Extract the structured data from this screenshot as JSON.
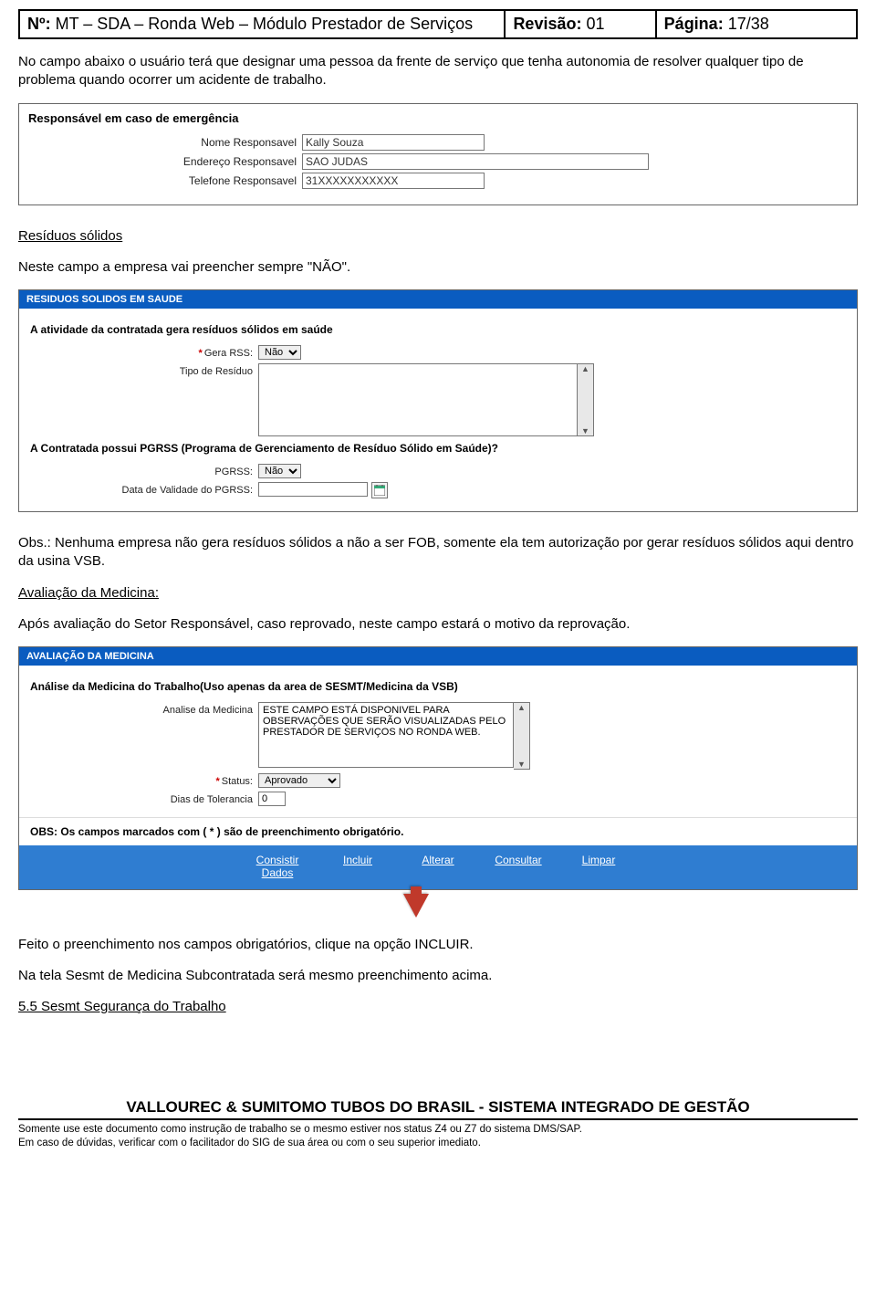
{
  "header": {
    "left_label": "Nº:",
    "left_value": "MT – SDA – Ronda Web – Módulo Prestador de Serviços",
    "mid_label": "Revisão:",
    "mid_value": "01",
    "right_label": "Página:",
    "right_value": "17/38"
  },
  "intro": "No campo abaixo o usuário terá que designar uma pessoa da frente de serviço que tenha autonomia de resolver qualquer tipo de problema quando ocorrer um acidente de trabalho.",
  "emergency": {
    "title": "Responsável em caso de emergência",
    "rows": [
      {
        "label": "Nome Responsavel",
        "value": "Kally Souza",
        "cls": "mid"
      },
      {
        "label": "Endereço Responsavel",
        "value": "SAO JUDAS",
        "cls": "long"
      },
      {
        "label": "Telefone Responsavel",
        "value": "31XXXXXXXXXXX",
        "cls": "mid"
      }
    ]
  },
  "residuos": {
    "heading": "Resíduos sólidos",
    "text": "Neste  campo a empresa vai preencher sempre \"NÃO\".",
    "bar": "RESIDUOS SOLIDOS EM SAUDE",
    "q1": "A atividade da contratada gera resíduos sólidos em saúde",
    "gera_label": "Gera RSS:",
    "gera_value": "Não",
    "tipo_label": "Tipo de Resíduo",
    "tipo_value": "",
    "q2": "A Contratada possui PGRSS (Programa de Gerenciamento de Resíduo Sólido em Saúde)?",
    "pgrss_label": "PGRSS:",
    "pgrss_value": "Não",
    "data_label": "Data de Validade do PGRSS:",
    "data_value": ""
  },
  "obs_text": "Obs.: Nenhuma empresa não gera resíduos sólidos a não a ser FOB, somente ela tem autorização por gerar resíduos sólidos aqui dentro da usina VSB.",
  "avaliacao": {
    "heading": "Avaliação da Medicina:",
    "intro": "Após avaliação do Setor Responsável, caso reprovado, neste campo estará o motivo da reprovação.",
    "bar": "AVALIAÇÃO DA MEDICINA",
    "q1": "Análise da Medicina do Trabalho(Uso apenas da area de SESMT/Medicina da VSB)",
    "analise_label": "Analise da Medicina",
    "analise_value": "ESTE CAMPO ESTÁ DISPONIVEL PARA OBSERVAÇÕES QUE SERÃO VISUALIZADAS PELO PRESTADOR DE SERVIÇOS NO RONDA WEB.",
    "status_label": "Status:",
    "status_value": "Aprovado",
    "dias_label": "Dias de Tolerancia",
    "dias_value": "0",
    "obs_bar": "OBS: Os campos marcados com ( * ) são de preenchimento obrigatório.",
    "buttons": [
      "Consistir\nDados",
      "Incluir",
      "Alterar",
      "Consultar",
      "Limpar"
    ]
  },
  "tail": {
    "p1": "Feito o preenchimento nos campos obrigatórios, clique na opção INCLUIR.",
    "p2": "Na tela Sesmt de Medicina Subcontratada será mesmo preenchimento acima.",
    "p3": "5.5 Sesmt Segurança do Trabalho"
  },
  "footer": {
    "title": "VALLOUREC & SUMITOMO TUBOS DO BRASIL - SISTEMA INTEGRADO DE GESTÃO",
    "l1": "Somente use este documento como instrução de trabalho se o mesmo estiver nos status Z4 ou Z7 do sistema DMS/SAP.",
    "l2": "Em caso de dúvidas, verificar com o facilitador do SIG de sua área ou com o seu superior imediato."
  }
}
